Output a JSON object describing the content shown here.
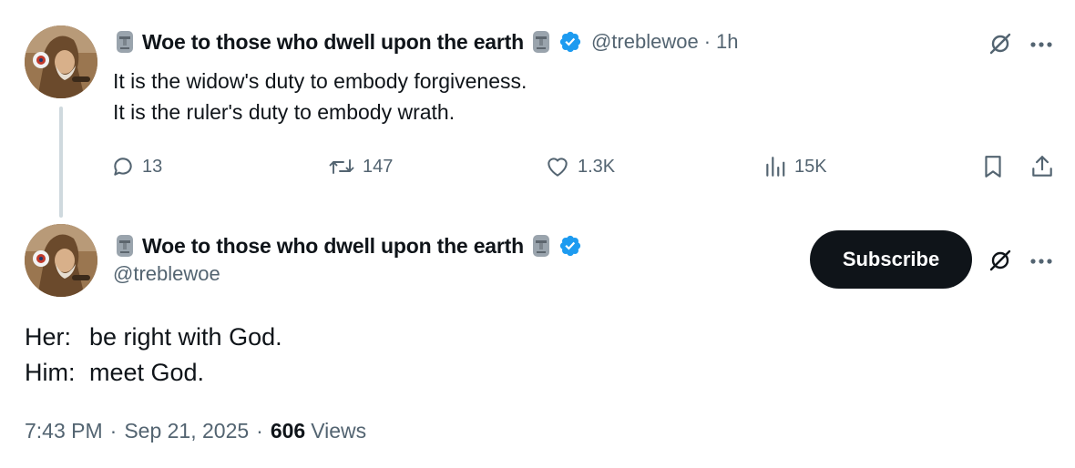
{
  "reply_to": {
    "author_name": "Woe to those who dwell upon the earth",
    "handle": "@treblewoe",
    "separator": "·",
    "time_ago": "1h",
    "text_lines": [
      "It is the widow's duty to embody forgiveness.",
      "It is the ruler's duty to embody wrath."
    ],
    "stats": {
      "replies": "13",
      "reposts": "147",
      "likes": "1.3K",
      "views": "15K"
    }
  },
  "main_tweet": {
    "author_name": "Woe to those who dwell upon the earth",
    "handle": "@treblewoe",
    "subscribe_label": "Subscribe",
    "lines": [
      {
        "label": "Her:",
        "text": "be right with God."
      },
      {
        "label": "Him:",
        "text": "meet God."
      }
    ],
    "time": "7:43 PM",
    "date": "Sep 21, 2025",
    "separator": "·",
    "views_count": "606",
    "views_label": "Views"
  },
  "icons": {
    "name_emoji": "moai-icon",
    "verified": "verified-badge-icon",
    "grok": "grok-icon",
    "more": "more-icon",
    "reply": "reply-icon",
    "repost": "repost-icon",
    "like": "like-icon",
    "views": "views-icon",
    "bookmark": "bookmark-icon",
    "share": "share-icon"
  },
  "colors": {
    "verified_blue": "#1d9bf0",
    "muted_text": "#536471",
    "primary_text": "#0f1419",
    "thread_line": "#cfd9de"
  }
}
